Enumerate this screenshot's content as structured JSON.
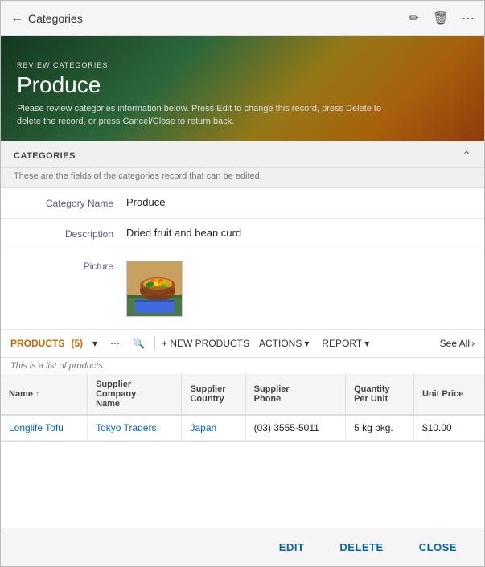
{
  "header": {
    "back_label": "Categories",
    "edit_icon": "✏",
    "delete_icon": "🗑",
    "more_icon": "⋯"
  },
  "hero": {
    "subtitle": "REVIEW CATEGORIES",
    "title": "Produce",
    "description": "Please review categories information below. Press Edit to change this record, press Delete to delete the record, or press Cancel/Close to return back."
  },
  "categories_section": {
    "title": "CATEGORIES",
    "subtitle": "These are the fields of the categories record that can be edited.",
    "fields": [
      {
        "label": "Category Name",
        "value": "Produce"
      },
      {
        "label": "Description",
        "value": "Dried fruit and bean curd"
      },
      {
        "label": "Picture",
        "value": ""
      }
    ]
  },
  "products_section": {
    "label": "PRODUCTS",
    "count": "(5)",
    "list_label": "This is a list of products.",
    "toolbar": {
      "more_icon": "⋯",
      "search_icon": "🔍",
      "new_label": "+ NEW PRODUCTS",
      "actions_label": "ACTIONS",
      "report_label": "REPORT",
      "see_all_label": "See All"
    },
    "columns": [
      {
        "label": "Name",
        "sortable": true
      },
      {
        "label": "Supplier Company Name"
      },
      {
        "label": "Supplier Country"
      },
      {
        "label": "Supplier Phone"
      },
      {
        "label": "Quantity Per Unit"
      },
      {
        "label": "Unit Price"
      }
    ],
    "rows": [
      {
        "name": "Longlife Tofu",
        "supplier_company": "Tokyo Traders",
        "supplier_country": "Japan",
        "supplier_phone": "(03) 3555-5011",
        "quantity_per_unit": "5 kg pkg.",
        "unit_price": "$10.00"
      }
    ]
  },
  "footer": {
    "edit_label": "EDIT",
    "delete_label": "DELETE",
    "close_label": "CLOSE"
  }
}
